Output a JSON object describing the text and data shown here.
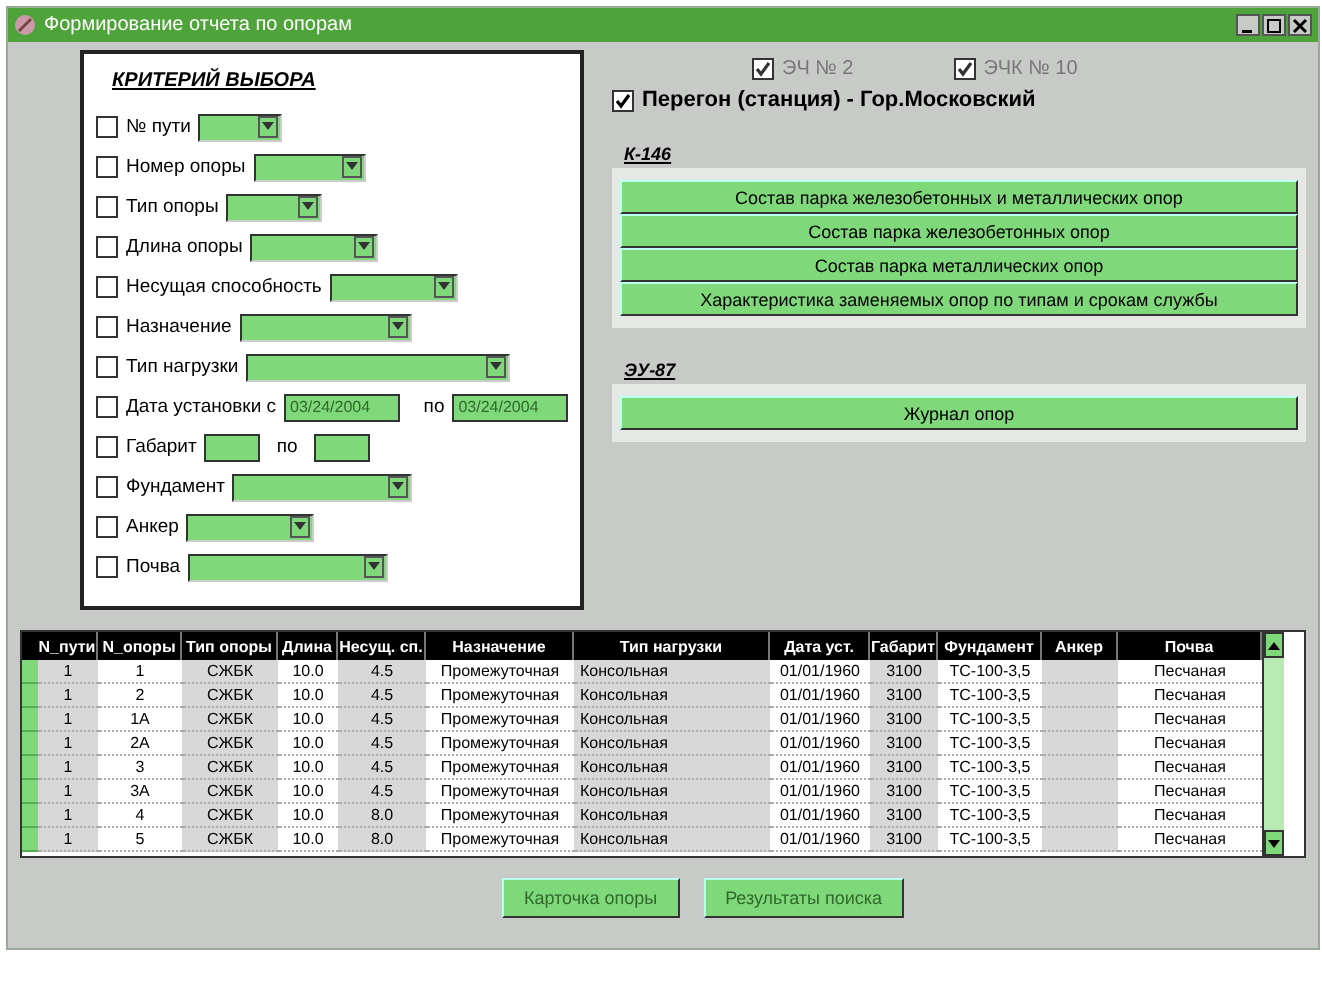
{
  "window": {
    "title": "Формирование отчета по опорам"
  },
  "criteria": {
    "title": "КРИТЕРИЙ ВЫБОРА",
    "items": [
      {
        "kind": "dropdown",
        "label": "№ пути",
        "checked": false
      },
      {
        "kind": "dropdown",
        "label": "Номер опоры",
        "checked": false
      },
      {
        "kind": "dropdown",
        "label": "Тип опоры",
        "checked": false
      },
      {
        "kind": "dropdown",
        "label": "Длина опоры",
        "checked": false
      },
      {
        "kind": "dropdown",
        "label": "Несущая способность",
        "checked": false
      },
      {
        "kind": "dropdown",
        "label": "Назначение",
        "checked": false
      },
      {
        "kind": "dropdown",
        "label": "Тип нагрузки",
        "checked": false
      },
      {
        "kind": "date_range",
        "label": "Дата установки с",
        "checked": false,
        "from": "03/24/2004",
        "to_label": "по",
        "to": "03/24/2004",
        "disabled": true
      },
      {
        "kind": "range",
        "label": "Габарит",
        "checked": false,
        "to_label": "по"
      },
      {
        "kind": "dropdown",
        "label": "Фундамент",
        "checked": false
      },
      {
        "kind": "dropdown",
        "label": "Анкер",
        "checked": false
      },
      {
        "kind": "dropdown",
        "label": "Почва",
        "checked": false
      }
    ]
  },
  "sections": [
    {
      "label": "ЭЧ № 2",
      "checked": true,
      "disabled": true
    },
    {
      "label": "ЭЧК № 10",
      "checked": true,
      "disabled": true
    }
  ],
  "stretch": {
    "label": "Перегон (станция) - Гор.Московский",
    "checked": true
  },
  "report_groups": [
    {
      "title": "К-146",
      "buttons": [
        "Состав парка железобетонных и металлических опор",
        "Состав парка железобетонных опор",
        "Состав парка металлических опор",
        "Характеристика заменяемых опор по типам и срокам службы"
      ]
    },
    {
      "title": "ЭУ-87",
      "buttons": [
        "Журнал опор"
      ]
    }
  ],
  "table": {
    "columns": [
      "N_пути",
      "N_опоры",
      "Тип опоры",
      "Длина",
      "Несущ. сп.",
      "Назначение",
      "Тип нагрузки",
      "Дата уст.",
      "Габарит",
      "Фундамент",
      "Анкер",
      "Почва"
    ],
    "rows": [
      [
        "1",
        "1",
        "СЖБК",
        "10.0",
        "4.5",
        "Промежуточная",
        "Консольная",
        "01/01/1960",
        "3100",
        "ТС-100-3,5",
        "",
        "Песчаная"
      ],
      [
        "1",
        "2",
        "СЖБК",
        "10.0",
        "4.5",
        "Промежуточная",
        "Консольная",
        "01/01/1960",
        "3100",
        "ТС-100-3,5",
        "",
        "Песчаная"
      ],
      [
        "1",
        "1А",
        "СЖБК",
        "10.0",
        "4.5",
        "Промежуточная",
        "Консольная",
        "01/01/1960",
        "3100",
        "ТС-100-3,5",
        "",
        "Песчаная"
      ],
      [
        "1",
        "2А",
        "СЖБК",
        "10.0",
        "4.5",
        "Промежуточная",
        "Консольная",
        "01/01/1960",
        "3100",
        "ТС-100-3,5",
        "",
        "Песчаная"
      ],
      [
        "1",
        "3",
        "СЖБК",
        "10.0",
        "4.5",
        "Промежуточная",
        "Консольная",
        "01/01/1960",
        "3100",
        "ТС-100-3,5",
        "",
        "Песчаная"
      ],
      [
        "1",
        "3А",
        "СЖБК",
        "10.0",
        "4.5",
        "Промежуточная",
        "Консольная",
        "01/01/1960",
        "3100",
        "ТС-100-3,5",
        "",
        "Песчаная"
      ],
      [
        "1",
        "4",
        "СЖБК",
        "10.0",
        "8.0",
        "Промежуточная",
        "Консольная",
        "01/01/1960",
        "3100",
        "ТС-100-3,5",
        "",
        "Песчаная"
      ],
      [
        "1",
        "5",
        "СЖБК",
        "10.0",
        "8.0",
        "Промежуточная",
        "Консольная",
        "01/01/1960",
        "3100",
        "ТС-100-3,5",
        "",
        "Песчаная"
      ]
    ]
  },
  "actions": [
    {
      "label": "Карточка опоры",
      "disabled": true
    },
    {
      "label": "Результаты поиска",
      "disabled": true
    }
  ]
}
